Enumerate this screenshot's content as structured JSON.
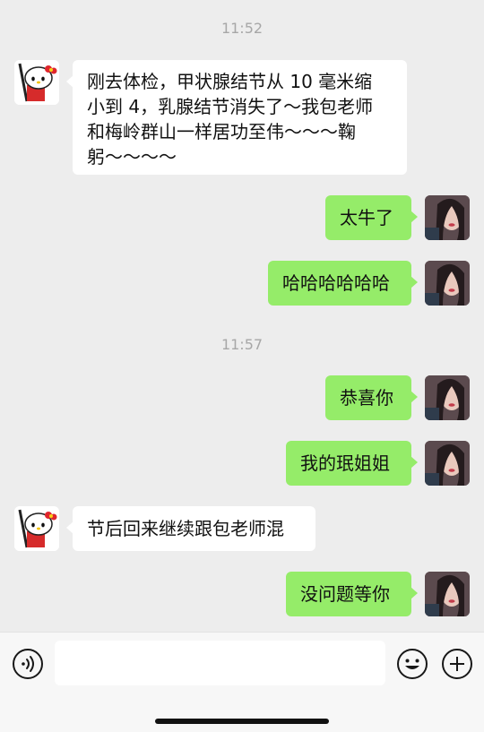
{
  "messages_area": {
    "timestamps": [
      "11:52",
      "11:57"
    ],
    "messages": [
      {
        "side": "left",
        "lines": [
          "刚去体检，甲状腺结节从 10 毫米缩",
          "小到 4，乳腺结节消失了～我包老师",
          "和梅岭群山一样居功至伟～～～鞠",
          "躬～～～～"
        ],
        "avatar": "hello-kitty-avatar"
      },
      {
        "side": "right",
        "text": "太牛了",
        "avatar": "girl-avatar"
      },
      {
        "side": "right",
        "text": "哈哈哈哈哈哈",
        "avatar": "girl-avatar"
      },
      {
        "side": "right",
        "text": "恭喜你",
        "avatar": "girl-avatar"
      },
      {
        "side": "right",
        "text": "我的珉姐姐",
        "avatar": "girl-avatar"
      },
      {
        "side": "left",
        "text": "节后回来继续跟包老师混",
        "avatar": "hello-kitty-avatar"
      },
      {
        "side": "right",
        "text": "没问题等你",
        "avatar": "girl-avatar"
      }
    ]
  },
  "input_bar": {
    "text_value": "",
    "icons": [
      "voice-icon",
      "emoji-icon",
      "plus-icon"
    ]
  },
  "colors": {
    "background": "#ededed",
    "sent_bubble": "#95ec69",
    "received_bubble": "#ffffff",
    "timestamp": "#a7a7a7"
  }
}
